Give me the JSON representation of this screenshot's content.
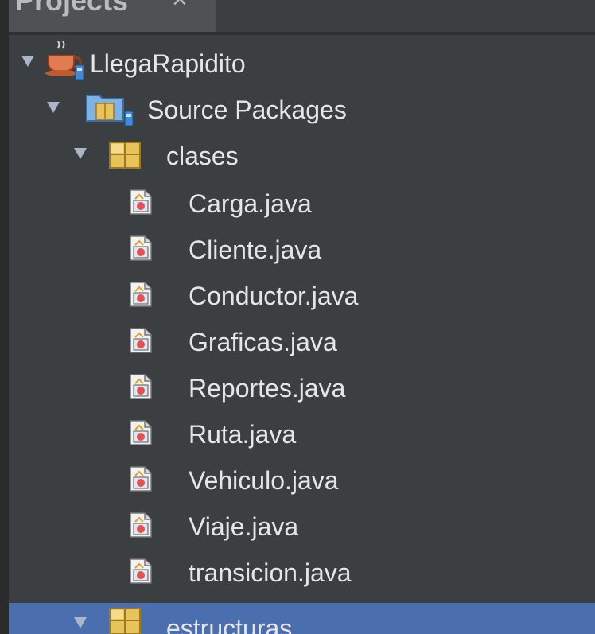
{
  "panel": {
    "tab_label": "Projects",
    "tab_close": "×"
  },
  "tree": {
    "project": {
      "label": "LlegaRapidito"
    },
    "source_packages": {
      "label": "Source Packages"
    },
    "package_clases": {
      "label": "clases",
      "files": [
        "Carga.java",
        "Cliente.java",
        "Conductor.java",
        "Graficas.java",
        "Reportes.java",
        "Ruta.java",
        "Vehiculo.java",
        "Viaje.java",
        "transicion.java"
      ]
    },
    "package_estructuras": {
      "label": "estructuras"
    }
  },
  "colors": {
    "background": "#3c3f41",
    "selection": "#4b6eaf",
    "text": "#e6e6e6",
    "package_yellow": "#e8c35a"
  }
}
